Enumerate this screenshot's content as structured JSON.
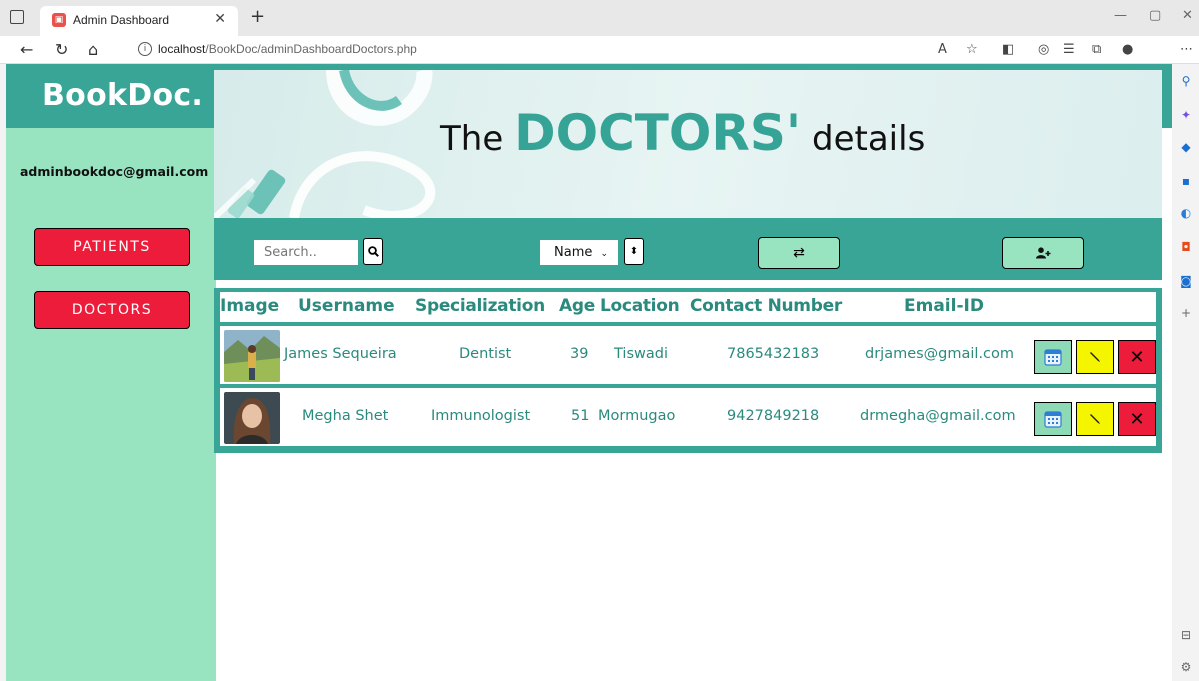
{
  "browser": {
    "tab_title": "Admin Dashboard",
    "url_host": "localhost",
    "url_path": "/BookDoc/adminDashboardDoctors.php"
  },
  "header": {
    "brand": "BookDoc."
  },
  "sidebar": {
    "admin_email": "adminbookdoc@gmail.com",
    "items": [
      {
        "label": "PATIENTS"
      },
      {
        "label": "DOCTORS"
      }
    ]
  },
  "banner": {
    "prefix": "The",
    "highlight": "DOCTORS'",
    "suffix": "details"
  },
  "toolbar": {
    "search_placeholder": "Search..",
    "sort_selected": "Name",
    "sort_options": [
      "Name"
    ]
  },
  "table": {
    "headers": [
      "Image",
      "Username",
      "Specialization",
      "Age",
      "Location",
      "Contact Number",
      "Email-ID"
    ],
    "rows": [
      {
        "username": "James Sequeira",
        "specialization": "Dentist",
        "age": "39",
        "location": "Tiswadi",
        "contact": "7865432183",
        "email": "drjames@gmail.com"
      },
      {
        "username": "Megha Shet",
        "specialization": "Immunologist",
        "age": "51",
        "location": "Mormugao",
        "contact": "9427849218",
        "email": "drmegha@gmail.com"
      }
    ]
  },
  "colors": {
    "teal": "#38a597",
    "mint": "#98e3c0",
    "red": "#ee1c3b",
    "yellow": "#f5f500"
  }
}
